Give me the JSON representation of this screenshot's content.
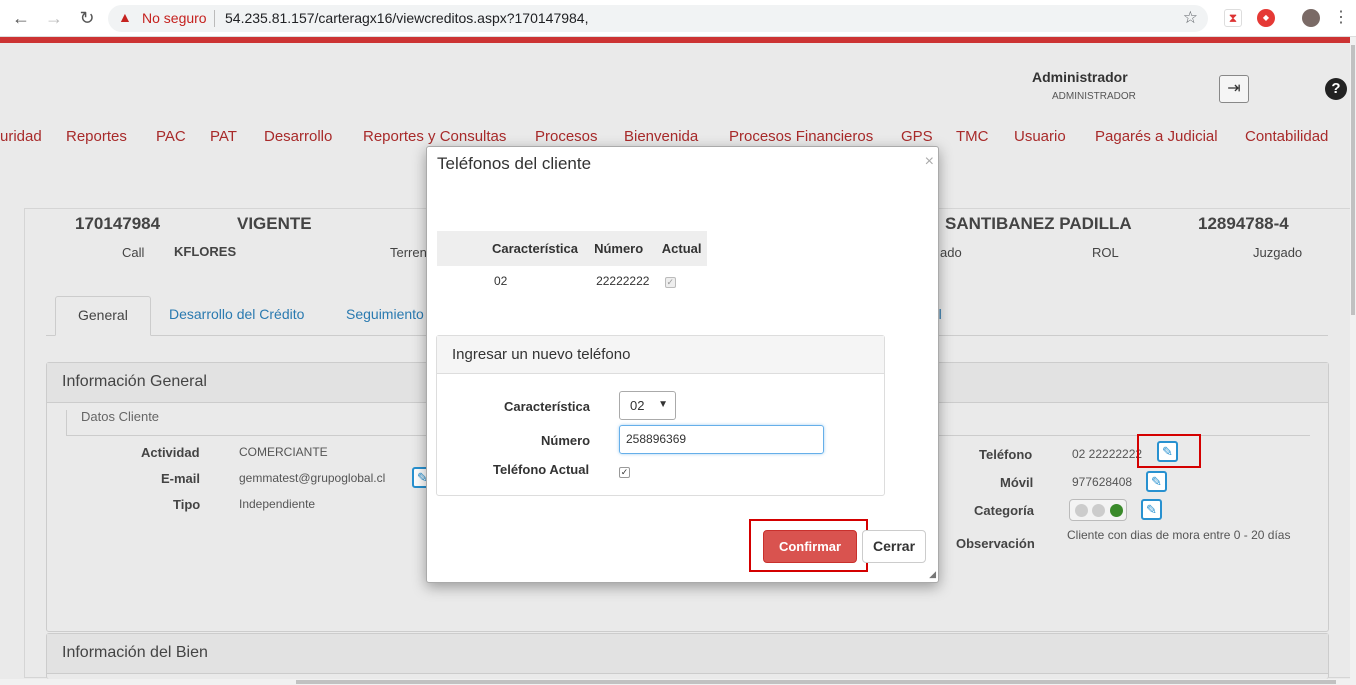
{
  "browser": {
    "security_label": "No seguro",
    "url": "54.235.81.157/carteragx16/viewcreditos.aspx?170147984,"
  },
  "user": {
    "name": "Administrador",
    "role": "ADMINISTRADOR",
    "help_label": "?"
  },
  "menu": [
    "uridad",
    "Reportes",
    "PAC",
    "PAT",
    "Desarrollo",
    "Reportes y Consultas",
    "Procesos",
    "Bienvenida",
    "Procesos Financieros",
    "GPS",
    "TMC",
    "Usuario",
    "Pagarés a Judicial",
    "Contabilidad"
  ],
  "credit_header": {
    "number": "170147984",
    "status": "VIGENTE",
    "client_name": "SANTIBANEZ PADILLA",
    "rut": "12894788-4",
    "call_label": "Call",
    "call_value": "KFLORES",
    "terreno_label": "Terren",
    "ado_label": "ado",
    "rol_label": "ROL",
    "juzgado_label": "Juzgado"
  },
  "tabs": [
    {
      "label": "General"
    },
    {
      "label": "Desarrollo del Crédito"
    },
    {
      "label": "Seguimiento"
    },
    {
      "label": "gal"
    }
  ],
  "info_general": {
    "title": "Información General",
    "datos_cliente_legend": "Datos Cliente",
    "actividad_label": "Actividad",
    "actividad_value": "COMERCIANTE",
    "email_label": "E-mail",
    "email_value": "gemmatest@grupoglobal.cl",
    "tipo_label": "Tipo",
    "tipo_value": "Independiente",
    "telefono_label": "Teléfono",
    "telefono_value": "02 22222222",
    "movil_label": "Móvil",
    "movil_value": "977628408",
    "categoria_label": "Categoría",
    "observacion_label": "Observación",
    "observacion_value": "Cliente con dias de mora entre 0 - 20 días"
  },
  "info_bien": {
    "title": "Información del Bien"
  },
  "modal": {
    "title": "Teléfonos del cliente",
    "close_symbol": "×",
    "table_headers": [
      "Característica",
      "Número",
      "Actual"
    ],
    "rows": [
      {
        "caracteristica": "02",
        "numero": "22222222",
        "actual": true
      }
    ],
    "new_phone": {
      "title": "Ingresar un nuevo teléfono",
      "caracteristica_label": "Característica",
      "caracteristica_value": "02",
      "numero_label": "Número",
      "numero_value": "258896369",
      "actual_label": "Teléfono Actual",
      "actual_checked": true
    },
    "confirm_label": "Confirmar",
    "close_label": "Cerrar"
  },
  "colors": {
    "accent_red": "#cc3333",
    "menu_red": "#a82a2a",
    "link_blue": "#2a7ab0",
    "confirm_red": "#d9534f",
    "highlight_red": "#d40000"
  }
}
